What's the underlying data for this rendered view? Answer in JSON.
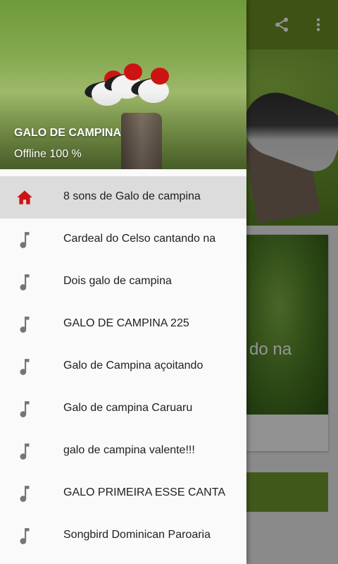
{
  "toolbar": {
    "share_icon": "share-icon",
    "overflow_icon": "more-vert-icon"
  },
  "background": {
    "card_text": "do na"
  },
  "drawer": {
    "header": {
      "title": "GALO DE CAMPINA",
      "subtitle": "Offline 100 %"
    },
    "items": [
      {
        "label": "8 sons de Galo de campina",
        "icon": "home-icon",
        "active": true
      },
      {
        "label": "Cardeal do Celso cantando na",
        "icon": "music-note-icon",
        "active": false
      },
      {
        "label": "Dois galo de campina",
        "icon": "music-note-icon",
        "active": false
      },
      {
        "label": "GALO DE CAMPINA 225",
        "icon": "music-note-icon",
        "active": false
      },
      {
        "label": "Galo de Campina açoitando",
        "icon": "music-note-icon",
        "active": false
      },
      {
        "label": "Galo de campina Caruaru",
        "icon": "music-note-icon",
        "active": false
      },
      {
        "label": "galo de campina valente!!!",
        "icon": "music-note-icon",
        "active": false
      },
      {
        "label": "GALO PRIMEIRA ESSE CANTA",
        "icon": "music-note-icon",
        "active": false
      },
      {
        "label": "Songbird Dominican Paroaria",
        "icon": "music-note-icon",
        "active": false
      }
    ]
  },
  "colors": {
    "accent_red": "#cc1414",
    "note_gray": "#757575",
    "toolbar_green": "#6b8e23"
  }
}
